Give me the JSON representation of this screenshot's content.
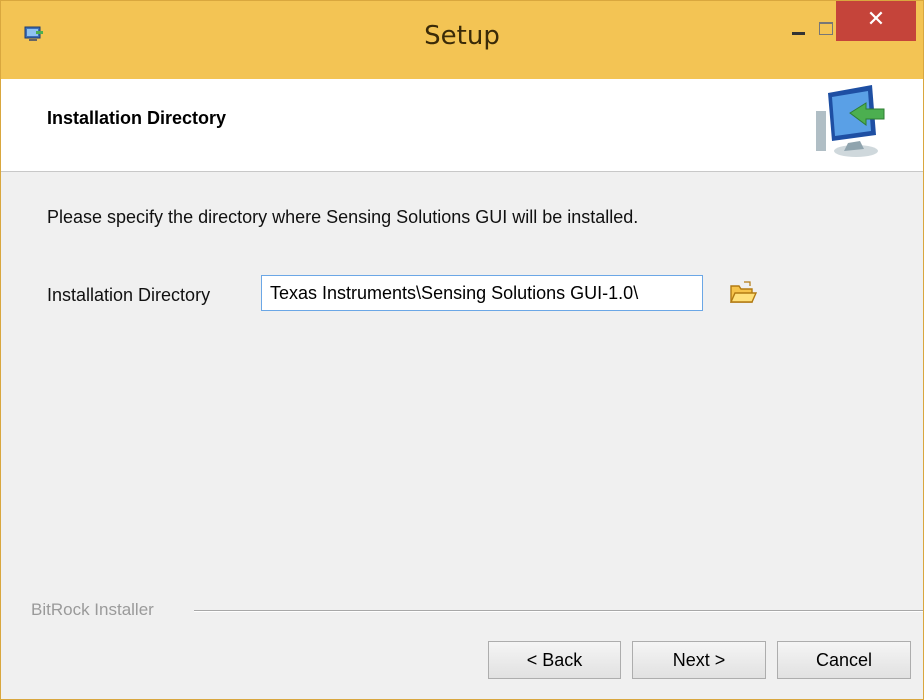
{
  "window": {
    "title": "Setup",
    "close_glyph": "✕",
    "icons": {
      "app": "installer-app-icon",
      "minimize": "minimize-icon",
      "maximize": "maximize-icon",
      "close": "close-icon"
    }
  },
  "header": {
    "title": "Installation Directory",
    "graphic": "computer-install-arrow-icon"
  },
  "body": {
    "instruction": "Please specify the directory where Sensing Solutions GUI will be installed.",
    "directory_label": "Installation Directory",
    "directory_value": "\\Texas Instruments\\Sensing Solutions GUI-1.0",
    "browse_icon": "folder-open-icon"
  },
  "footer": {
    "brand": "BitRock Installer",
    "back_label": "< Back",
    "next_label": "Next >",
    "cancel_label": "Cancel"
  },
  "colors": {
    "titlebar": "#f3c454",
    "close_button": "#c5443a",
    "input_border": "#6ba7e6",
    "background": "#f0f0f0"
  }
}
